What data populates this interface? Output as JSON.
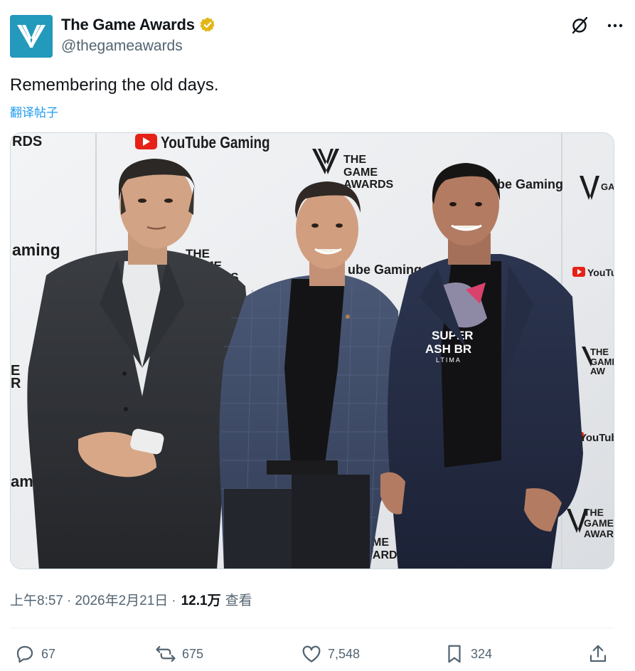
{
  "author": {
    "display_name": "The Game Awards",
    "handle": "@thegameawards",
    "verified_color": "#e2b719",
    "avatar_bg": "#2399bb"
  },
  "tweet": {
    "text": "Remembering the old days.",
    "translate_label": "翻译帖子"
  },
  "photo": {
    "backdrop": {
      "youtube_gaming": "YouTube Gaming",
      "youtube": "YouTube",
      "game_awards_line1": "THE",
      "game_awards_line2": "GAME",
      "game_awards_line3": "AWARDS",
      "fragment_rds": "RDS",
      "fragment_aming": "aming",
      "fragment_ube_gaming": "ube Gaming",
      "fragment_amin": "amin",
      "fragment_e": "E",
      "fragment_r": "R",
      "fragment_ga": "GA",
      "fragment_aw": "AW",
      "fragment_awar": "AWAR",
      "fragment_youtube_ga": "YouTube Ga"
    },
    "shirt_text_1": "SUPER",
    "shirt_text_2": "ASH BR",
    "shirt_text_3": "LTIMA"
  },
  "meta": {
    "time": "上午8:57",
    "separator": "·",
    "date": "2026年2月21日",
    "views_count": "12.1万",
    "views_label": "查看"
  },
  "actions": {
    "replies": "67",
    "reposts": "675",
    "likes": "7,548",
    "bookmarks": "324"
  },
  "icons": {
    "grok": "grok-icon",
    "more": "more-icon",
    "reply": "reply-icon",
    "repost": "repost-icon",
    "like": "heart-icon",
    "bookmark": "bookmark-icon",
    "share": "share-icon"
  },
  "colors": {
    "text_primary": "#0f1419",
    "text_secondary": "#536471",
    "link": "#1d9bf0",
    "youtube_red": "#e62117"
  }
}
